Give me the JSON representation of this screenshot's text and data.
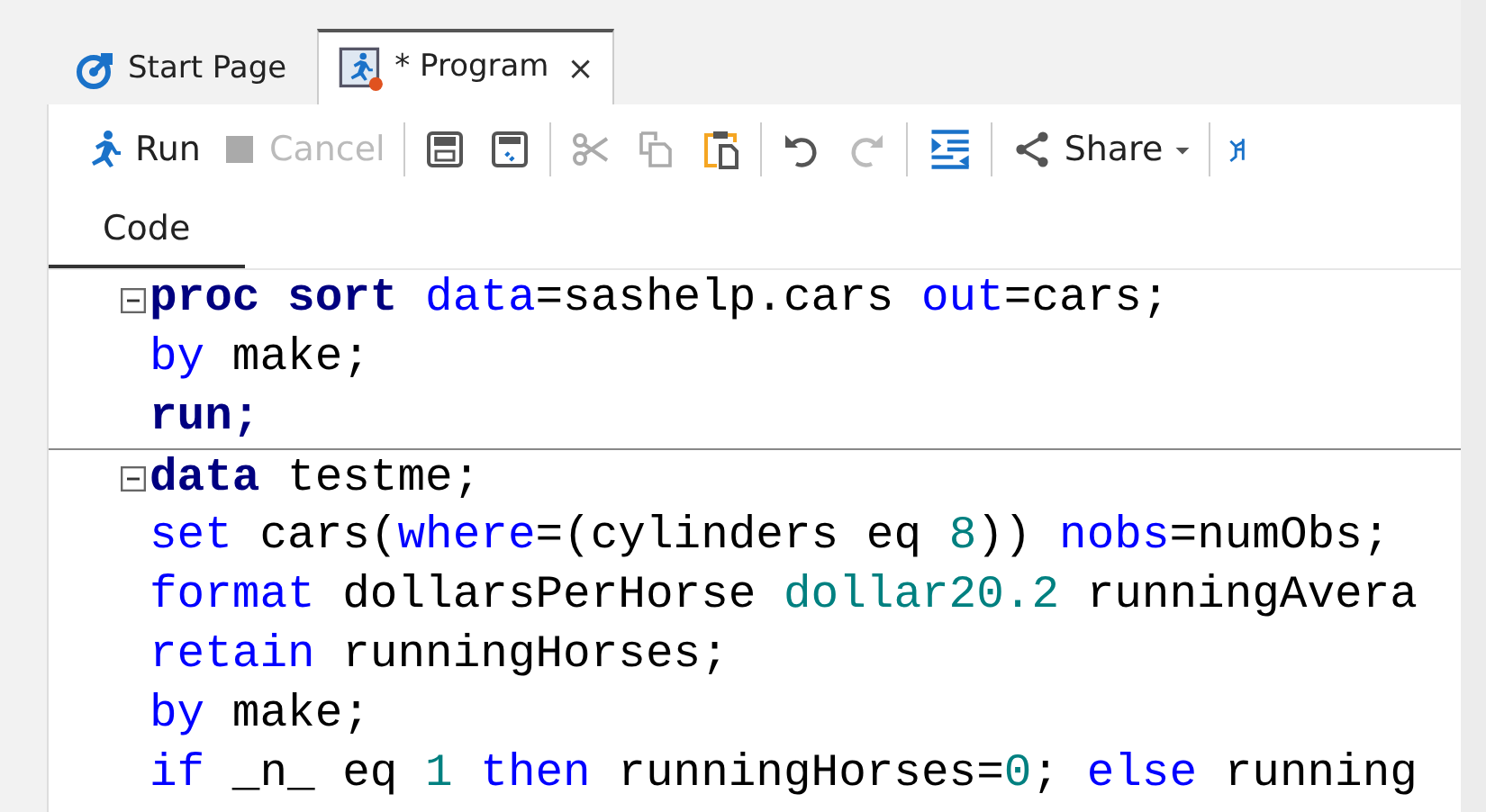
{
  "tabs": [
    {
      "label": "Start Page",
      "selected": false
    },
    {
      "label": "* Program",
      "selected": true,
      "modified": true,
      "close": "×"
    }
  ],
  "toolbar": {
    "groups": [
      [
        {
          "label": "Run",
          "disabled": false
        },
        {
          "label": "Cancel",
          "disabled": true
        }
      ],
      [
        {
          "disabled": false
        },
        {
          "disabled": false
        }
      ],
      [
        {
          "disabled": true
        },
        {
          "disabled": true
        },
        {
          "disabled": false
        }
      ],
      [
        {
          "disabled": false
        },
        {
          "disabled": true
        }
      ],
      [
        {
          "disabled": false
        }
      ],
      [
        {
          "label": "Share",
          "disabled": false,
          "dropdown": true
        }
      ],
      [
        {
          "disabled": false
        }
      ]
    ]
  },
  "subtabs": [
    {
      "label": "Code",
      "selected": true
    }
  ],
  "code": [
    {
      "fold_open": true,
      "tokens": [
        {
          "text": "proc sort ",
          "kind": "keyword"
        },
        {
          "text": "data",
          "kind": "option"
        },
        {
          "text": "=sashelp.cars ",
          "kind": "plain"
        },
        {
          "text": "out",
          "kind": "option"
        },
        {
          "text": "=cars;",
          "kind": "plain"
        }
      ]
    },
    {
      "tokens": [
        {
          "text": "by",
          "kind": "option"
        },
        {
          "text": " make;",
          "kind": "plain"
        }
      ]
    },
    {
      "tokens": [
        {
          "text": "run;",
          "kind": "keyword"
        }
      ]
    },
    {
      "fold_open": true,
      "tokens": [
        {
          "text": "data",
          "kind": "keyword"
        },
        {
          "text": " testme;",
          "kind": "plain"
        }
      ]
    },
    {
      "tokens": [
        {
          "text": "set",
          "kind": "option"
        },
        {
          "text": " cars(",
          "kind": "plain"
        },
        {
          "text": "where",
          "kind": "option"
        },
        {
          "text": "=(cylinders eq ",
          "kind": "plain"
        },
        {
          "text": "8",
          "kind": "number"
        },
        {
          "text": ")) ",
          "kind": "plain"
        },
        {
          "text": "nobs",
          "kind": "option"
        },
        {
          "text": "=numObs;",
          "kind": "plain"
        }
      ]
    },
    {
      "tokens": [
        {
          "text": "format",
          "kind": "option"
        },
        {
          "text": " dollarsPerHorse ",
          "kind": "plain"
        },
        {
          "text": "dollar20.2",
          "kind": "number"
        },
        {
          "text": " runningAvera",
          "kind": "plain"
        }
      ]
    },
    {
      "tokens": [
        {
          "text": "retain",
          "kind": "option"
        },
        {
          "text": " runningHorses;",
          "kind": "plain"
        }
      ]
    },
    {
      "tokens": [
        {
          "text": "by",
          "kind": "option"
        },
        {
          "text": " make;",
          "kind": "plain"
        }
      ]
    },
    {
      "tokens": [
        {
          "text": "if",
          "kind": "option"
        },
        {
          "text": " _n_ eq ",
          "kind": "plain"
        },
        {
          "text": "1",
          "kind": "number"
        },
        {
          "text": " then",
          "kind": "option"
        },
        {
          "text": " runningHorses=",
          "kind": "plain"
        },
        {
          "text": "0",
          "kind": "number"
        },
        {
          "text": "; ",
          "kind": "plain"
        },
        {
          "text": "else",
          "kind": "option"
        },
        {
          "text": " running",
          "kind": "plain"
        }
      ]
    }
  ]
}
